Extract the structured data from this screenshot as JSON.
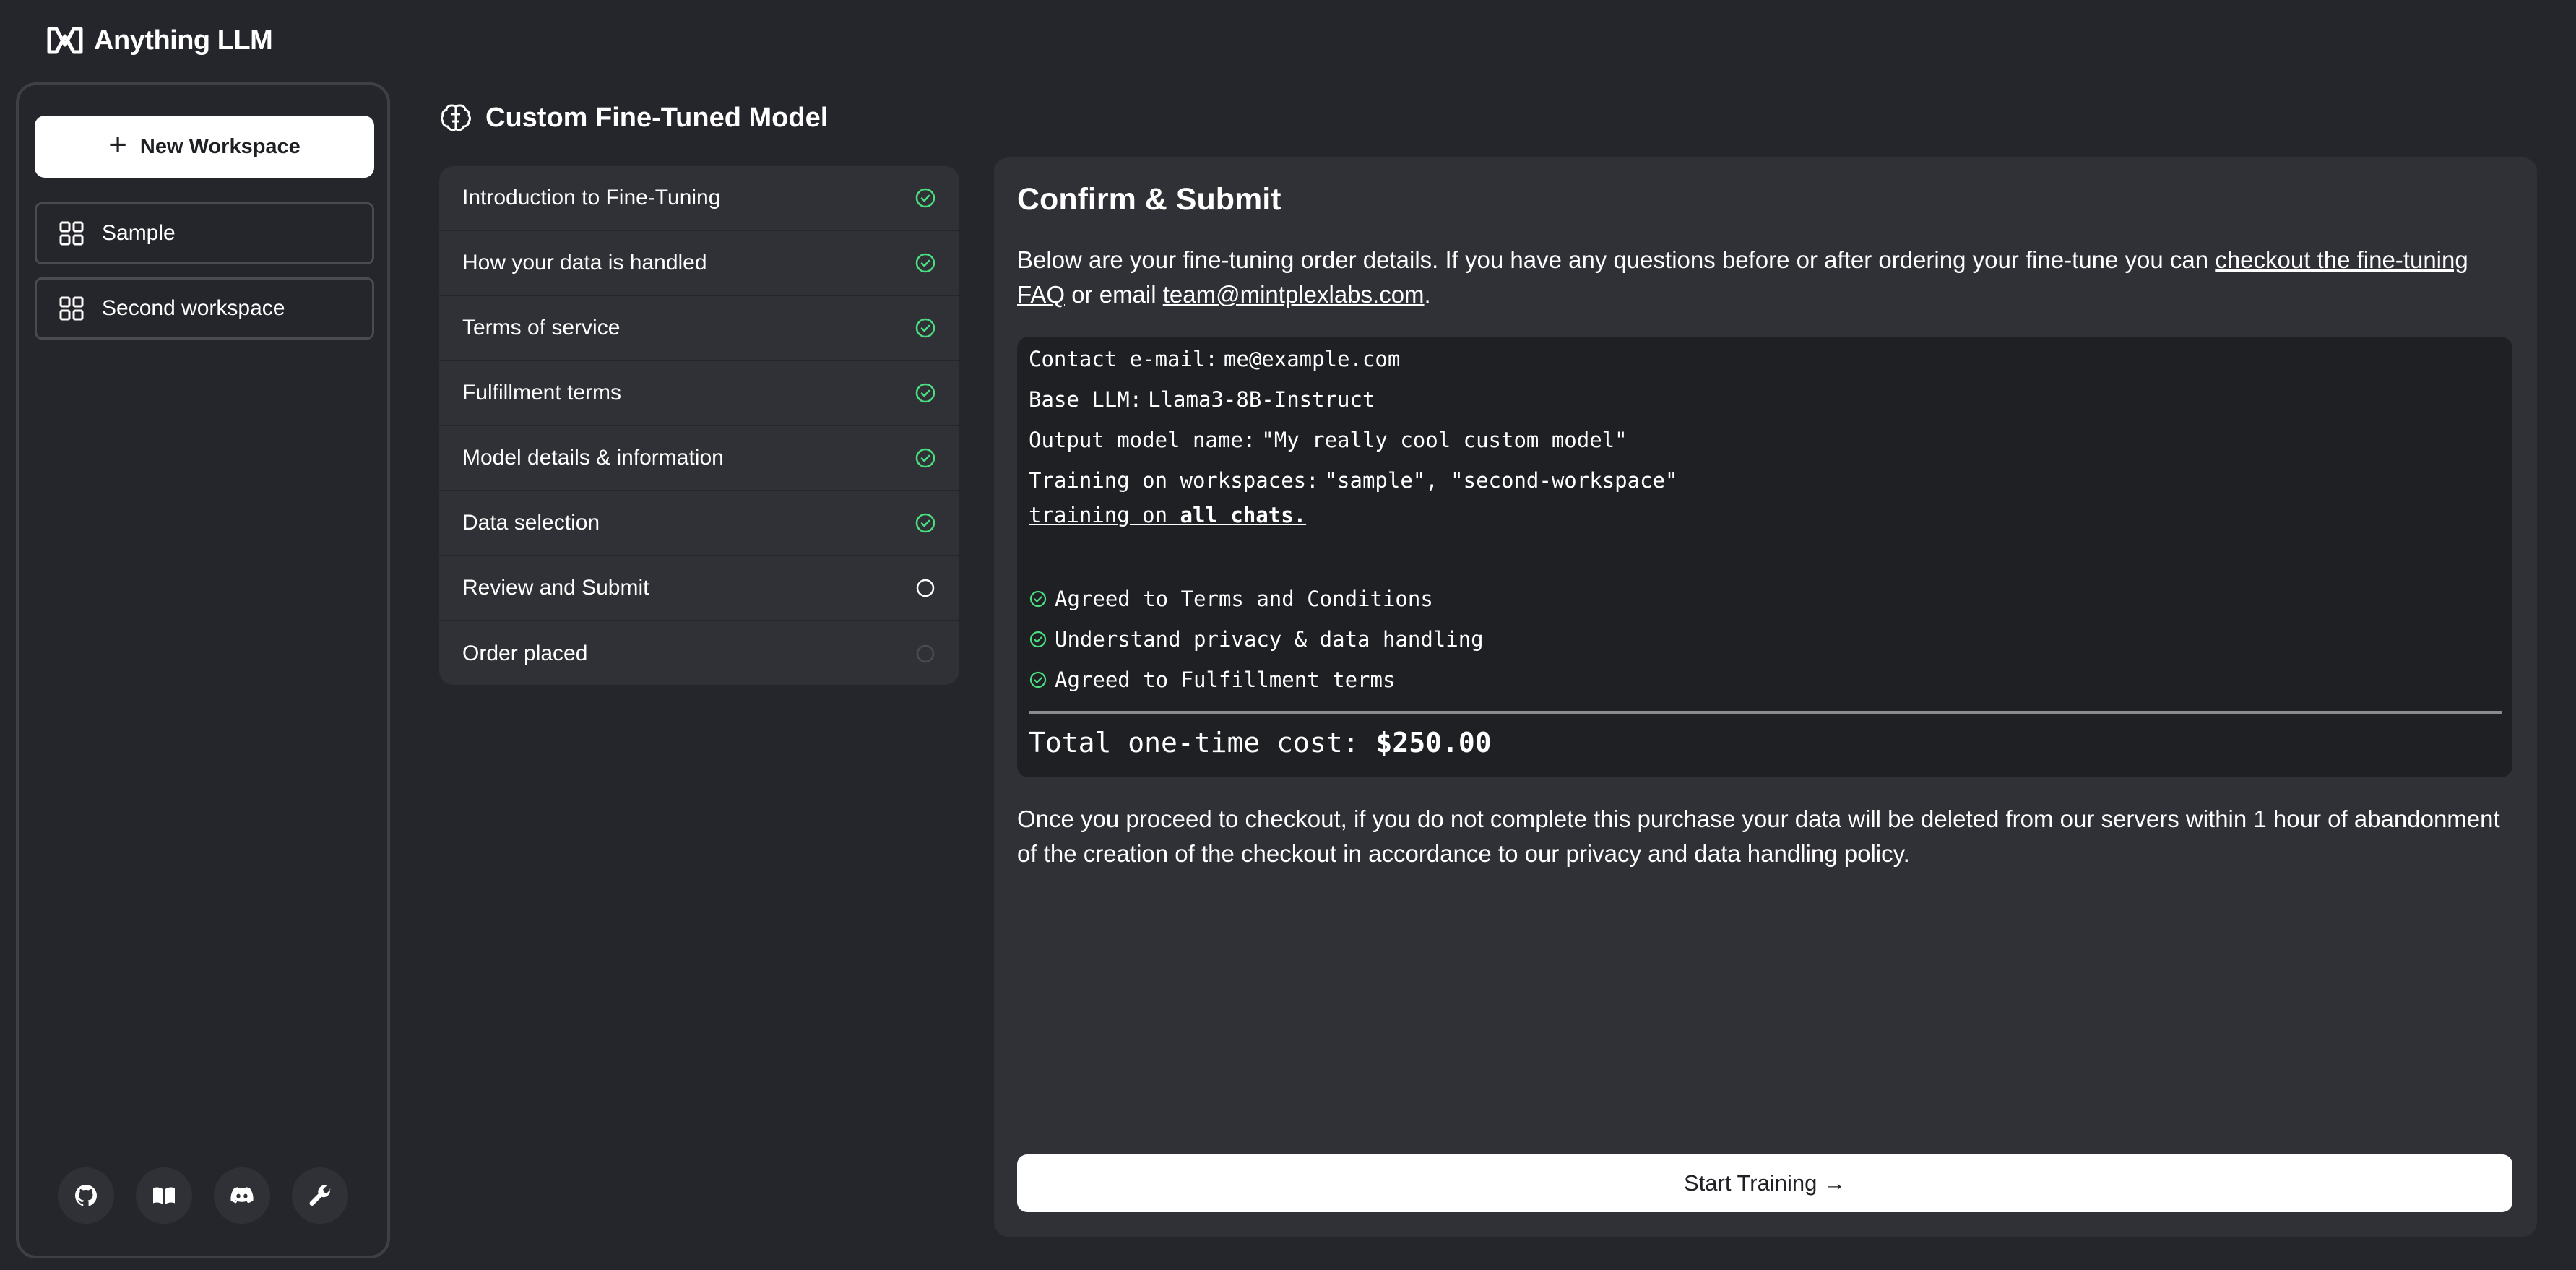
{
  "app": {
    "name": "Anything LLM",
    "logo_icon": "anythingllm-logo-icon"
  },
  "sidebar": {
    "new_workspace_label": "New Workspace",
    "workspaces": [
      {
        "label": "Sample",
        "icon": "grid-icon"
      },
      {
        "label": "Second workspace",
        "icon": "grid-icon"
      }
    ],
    "footer_icons": [
      "github-icon",
      "book-icon",
      "discord-icon",
      "wrench-icon"
    ]
  },
  "page": {
    "title": "Custom Fine-Tuned Model",
    "title_icon": "brain-icon"
  },
  "steps": [
    {
      "label": "Introduction to Fine-Tuning",
      "status": "complete"
    },
    {
      "label": "How your data is handled",
      "status": "complete"
    },
    {
      "label": "Terms of service",
      "status": "complete"
    },
    {
      "label": "Fulfillment terms",
      "status": "complete"
    },
    {
      "label": "Model details & information",
      "status": "complete"
    },
    {
      "label": "Data selection",
      "status": "complete"
    },
    {
      "label": "Review and Submit",
      "status": "current"
    },
    {
      "label": "Order placed",
      "status": "pending"
    }
  ],
  "panel": {
    "title": "Confirm & Submit",
    "intro_prefix": "Below are your fine-tuning order details. If you have any questions before or after ordering your fine-tune you can ",
    "intro_link_faq": "checkout the fine-tuning FAQ",
    "intro_middle": " or email ",
    "intro_link_email": "team@mintplexlabs.com",
    "intro_suffix": ".",
    "details": {
      "contact_label": "Contact e-mail:",
      "contact_value": "me@example.com",
      "base_llm_label": "Base LLM:",
      "base_llm_value": "Llama3-8B-Instruct",
      "output_label": "Output model name:",
      "output_value": "\"My really cool custom model\"",
      "workspaces_label": "Training on workspaces:",
      "workspaces_value": "\"sample\", \"second-workspace\"",
      "training_on_prefix": "training on ",
      "training_on_value": "all chats.",
      "agreements": [
        "Agreed to Terms and Conditions",
        "Understand privacy & data handling",
        "Agreed to Fulfillment terms"
      ],
      "total_label": "Total one-time cost:",
      "total_value": "$250.00"
    },
    "outro": "Once you proceed to checkout, if you do not complete this purchase your data will be deleted from our servers within 1 hour of abandonment of the creation of the checkout in accordance to our privacy and data handling policy.",
    "start_button": "Start Training →"
  },
  "colors": {
    "background": "#25262b",
    "panel": "#303136",
    "details_bg": "#1f2024",
    "check_green": "#4ade80",
    "button_bg": "#ffffff"
  }
}
